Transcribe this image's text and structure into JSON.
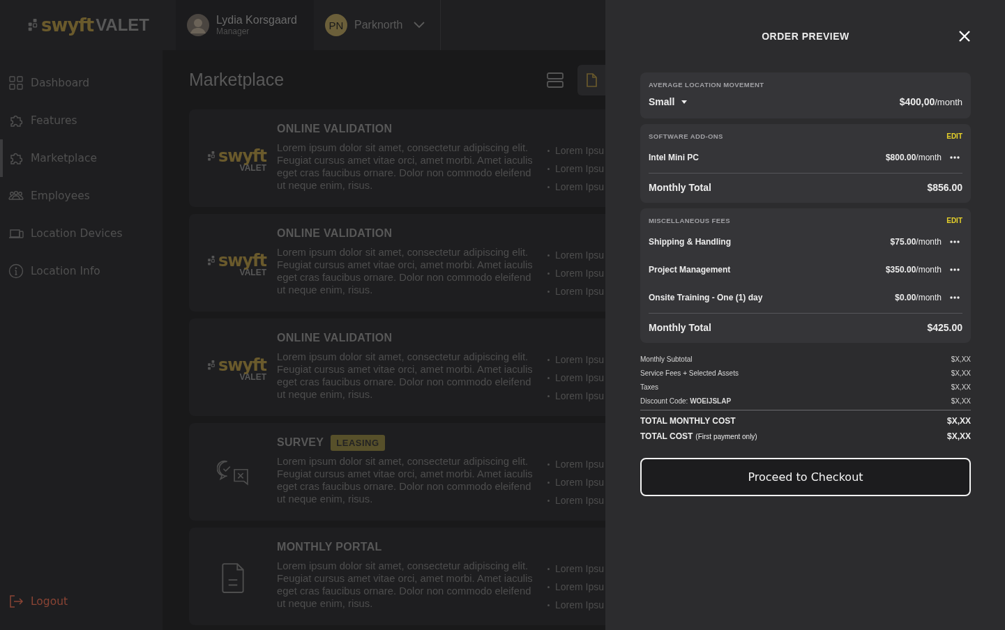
{
  "header": {
    "logo": {
      "brand": "swyft",
      "suffix": "VALET"
    },
    "user": {
      "name": "Lydia Korsgaard",
      "role": "Manager"
    },
    "location": {
      "initials": "PN",
      "name": "Parknorth"
    }
  },
  "sidebar": {
    "items": [
      {
        "label": "Dashboard",
        "kind": "grid",
        "selected": false
      },
      {
        "label": "Features",
        "kind": "puzzle",
        "selected": false
      },
      {
        "label": "Marketplace",
        "kind": "puzzle",
        "selected": true
      },
      {
        "label": "Employees",
        "kind": "people",
        "selected": false
      },
      {
        "label": "Location Devices",
        "kind": "devices",
        "selected": false
      },
      {
        "label": "Location Info",
        "kind": "info",
        "selected": false
      }
    ],
    "logout": "Logout"
  },
  "main": {
    "title": "Marketplace",
    "cards": [
      {
        "kind": "logo",
        "logo": {
          "brand": "swyft",
          "suffix": "VALET"
        },
        "title": "ONLINE VALIDATION",
        "description": "Lorem ipsum dolor sit amet, consectetur adipiscing elit. Feugiat cursus amet vitae orci, amet morbi. Amet iaculis eget cras faucibus ornare. Dolor non commodo eleifend ut neque enim, risus.",
        "bullets": [
          "Lorem Ipsu",
          "Lorem Ipsu",
          "Lorem Ipsu"
        ]
      },
      {
        "kind": "logo",
        "logo": {
          "brand": "swyft",
          "suffix": "VALET"
        },
        "title": "ONLINE VALIDATION",
        "description": "Lorem ipsum dolor sit amet, consectetur adipiscing elit. Feugiat cursus amet vitae orci, amet morbi. Amet iaculis eget cras faucibus ornare. Dolor non commodo eleifend ut neque enim, risus.",
        "bullets": [
          "Lorem Ipsu",
          "Lorem Ipsu",
          "Lorem Ipsu"
        ]
      },
      {
        "kind": "logo",
        "logo": {
          "brand": "swyft",
          "suffix": "VALET"
        },
        "title": "ONLINE VALIDATION",
        "description": "Lorem ipsum dolor sit amet, consectetur adipiscing elit. Feugiat cursus amet vitae orci, amet morbi. Amet iaculis eget cras faucibus ornare. Dolor non commodo eleifend ut neque enim, risus.",
        "bullets": [
          "Lorem Ipsu",
          "Lorem Ipsu",
          "Lorem Ipsu"
        ]
      },
      {
        "kind": "survey",
        "title": "SURVEY",
        "badge": "LEASING",
        "description": "Lorem ipsum dolor sit amet, consectetur adipiscing elit. Feugiat cursus amet vitae orci, amet morbi. Amet iaculis eget cras faucibus ornare. Dolor non commodo eleifend ut neque enim, risus.",
        "bullets": [
          "Lorem Ipsu",
          "Lorem Ipsu",
          "Lorem Ipsu"
        ]
      },
      {
        "kind": "document",
        "title": "MONTHLY PORTAL",
        "description": "Lorem ipsum dolor sit amet, consectetur adipiscing elit. Feugiat cursus amet vitae orci, amet morbi. Amet iaculis eget cras faucibus ornare. Dolor non commodo eleifend ut neque enim, risus.",
        "bullets": [
          "Lorem Ipsu",
          "Lorem Ipsu",
          "Lorem Ipsu"
        ]
      }
    ]
  },
  "order_preview": {
    "title": "ORDER PREVIEW",
    "movement": {
      "label": "AVERAGE LOCATION MOVEMENT",
      "size": "Small",
      "price": "$400,00",
      "unit": "/month"
    },
    "sections": [
      {
        "title": "SOFTWARE ADD-ONS",
        "action": "EDIT",
        "items": [
          {
            "name": "Intel Mini PC",
            "price": "$800.00",
            "unit": "/month"
          }
        ],
        "total_label": "Monthly Total",
        "total": "$856.00"
      },
      {
        "title": "MISCELLANEOUS FEES",
        "action": "EDIT",
        "items": [
          {
            "name": "Shipping & Handling",
            "price": "$75.00",
            "unit": "/month"
          },
          {
            "name": "Project Management",
            "price": "$350.00",
            "unit": "/month"
          },
          {
            "name": "Onsite Training - One (1) day",
            "price": "$0.00",
            "unit": "/month"
          }
        ],
        "total_label": "Monthly Total",
        "total": "$425.00"
      }
    ],
    "summary": [
      {
        "label": "Monthly Subtotal",
        "value": "$X,XX"
      },
      {
        "label": "Service Fees + Selected Assets",
        "value": "$X,XX"
      },
      {
        "label": "Taxes",
        "value": "$X,XX"
      },
      {
        "label": "Discount Code: **WOEIJSLAP**",
        "value": "$X,XX"
      }
    ],
    "totals": [
      {
        "label": "TOTAL MONTHLY COST",
        "value": "$X,XX"
      },
      {
        "label": "TOTAL COST",
        "note": "(First payment only)",
        "value": "$X,XX"
      }
    ],
    "checkout": "Proceed to Checkout"
  }
}
